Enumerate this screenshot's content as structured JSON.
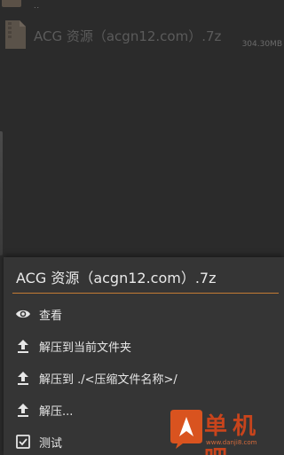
{
  "file_list": {
    "parent_dots": "..",
    "items": [
      {
        "name": "ACG 资源（acgn12.com）.7z",
        "size": "304.30MB",
        "icon": "archive-file-icon"
      }
    ]
  },
  "sheet": {
    "title": "ACG 资源（acgn12.com）.7z",
    "items": [
      {
        "label": "查看",
        "icon": "eye-icon"
      },
      {
        "label": "解压到当前文件夹",
        "icon": "upload-icon"
      },
      {
        "label": "解压到 ./<压缩文件名称>/",
        "icon": "upload-icon"
      },
      {
        "label": "解压...",
        "icon": "upload-icon"
      },
      {
        "label": "测试",
        "icon": "checkbox-icon"
      }
    ]
  },
  "watermark": {
    "text": "单机吧",
    "url": "www.danji8.com"
  },
  "colors": {
    "accent_divider": "#c47b34",
    "sheet_bg": "#353535",
    "page_bg": "#2b2b2b",
    "watermark": "#c8441c"
  }
}
